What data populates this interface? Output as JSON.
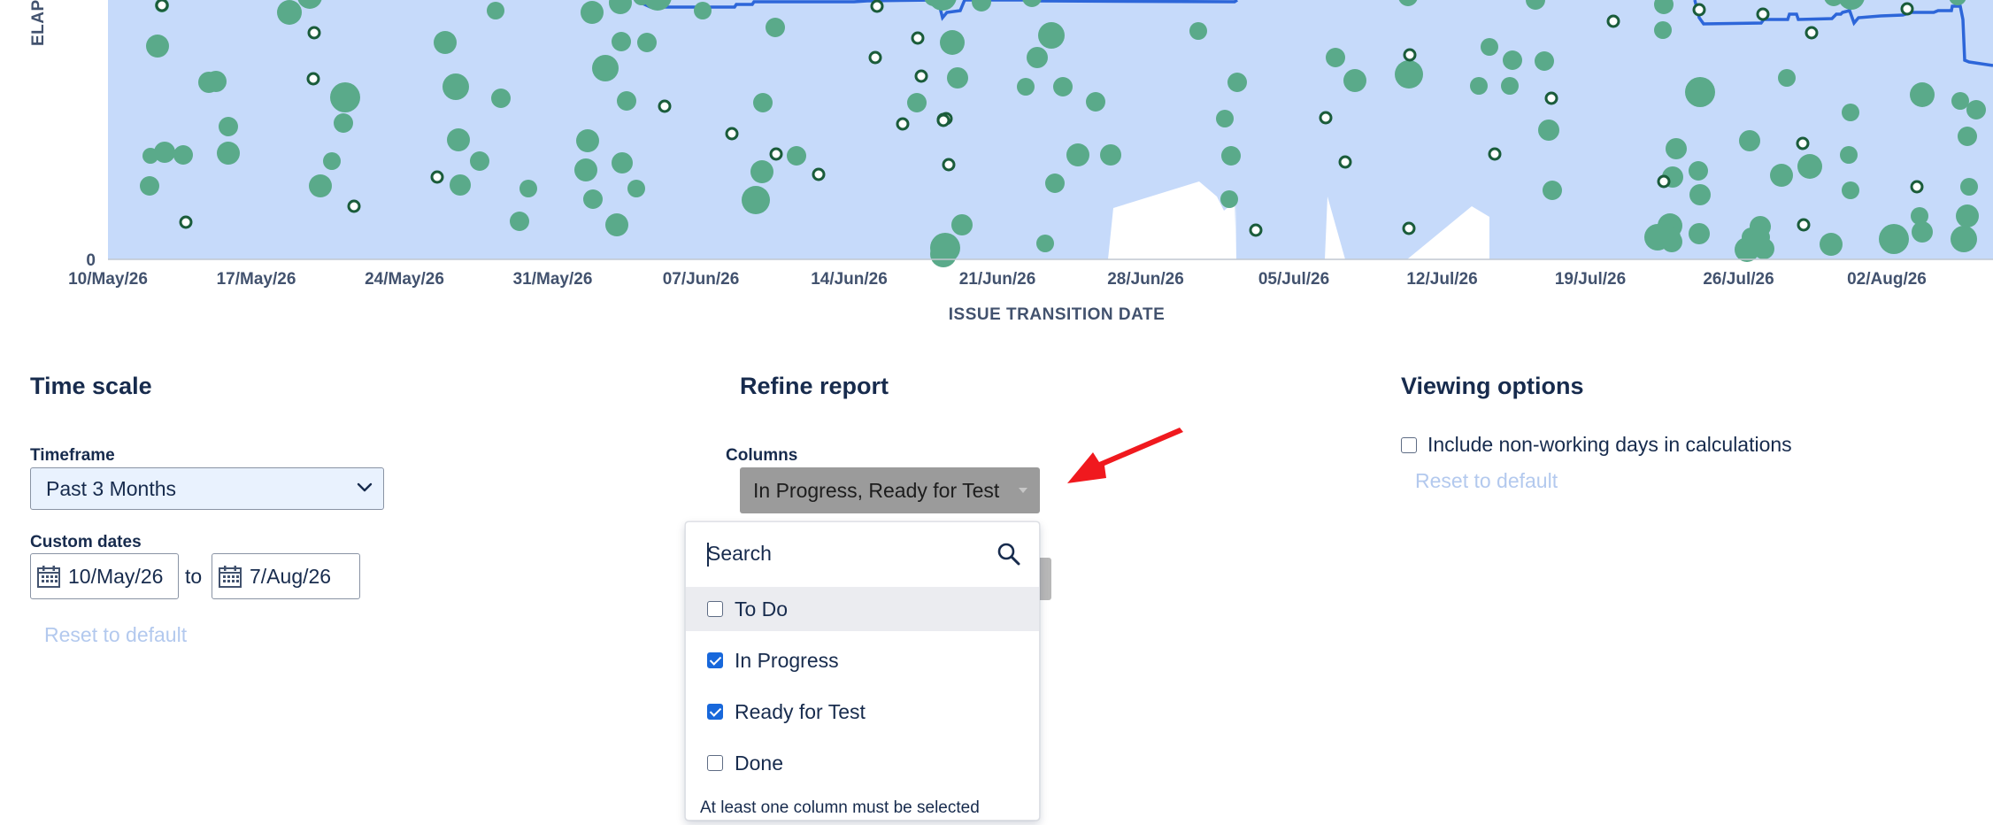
{
  "chart": {
    "y_axis_label": "ELAP",
    "y_zero_label": "0",
    "x_axis_title": "ISSUE TRANSITION DATE",
    "x_tick_labels": [
      "10/May/26",
      "17/May/26",
      "24/May/26",
      "31/May/26",
      "07/Jun/26",
      "14/Jun/26",
      "21/Jun/26",
      "28/Jun/26",
      "05/Jul/26",
      "12/Jul/26",
      "19/Jul/26",
      "26/Jul/26",
      "02/Aug/26"
    ],
    "colors": {
      "area": "#c6dafa",
      "issue_dot": "#5aaa8a",
      "outlier_ring": "#1a5c3a",
      "line": "#2d66d9"
    }
  },
  "chart_data": {
    "type": "scatter",
    "xlabel": "ISSUE TRANSITION DATE",
    "ylabel": "ELAP",
    "x_range": [
      "10/May/26",
      "07/Aug/26"
    ],
    "y_min": 0,
    "grid": false
  },
  "time_scale": {
    "title": "Time scale",
    "timeframe_label": "Timeframe",
    "timeframe_value": "Past 3 Months",
    "custom_dates_label": "Custom dates",
    "from_date": "10/May/26",
    "to_text": "to",
    "to_date": "7/Aug/26",
    "reset_label": "Reset to default"
  },
  "refine_report": {
    "title": "Refine report",
    "columns_label": "Columns",
    "columns_value": "In Progress, Ready for Test",
    "dropdown": {
      "search_placeholder": "Search",
      "options": [
        {
          "label": "To Do",
          "checked": false
        },
        {
          "label": "In Progress",
          "checked": true
        },
        {
          "label": "Ready for Test",
          "checked": true
        },
        {
          "label": "Done",
          "checked": false
        }
      ],
      "hint": "At least one column must be selected"
    }
  },
  "viewing_options": {
    "title": "Viewing options",
    "non_working_label": "Include non-working days in calculations",
    "non_working_checked": false,
    "reset_label": "Reset to default"
  },
  "annotation": {
    "arrow_color": "#f0191e"
  }
}
